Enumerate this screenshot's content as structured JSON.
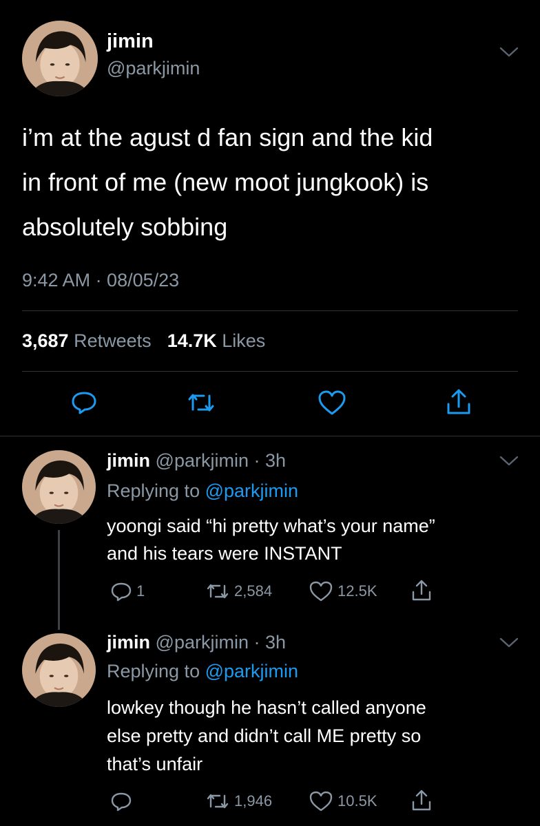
{
  "main_tweet": {
    "display_name": "jimin",
    "handle": "@parkjimin",
    "text_lines": [
      "i’m at the agust d fan sign and the kid",
      "in front of me (new moot jungkook) is",
      "absolutely sobbing"
    ],
    "timestamp": "9:42 AM · 08/05/23",
    "retweets_count": "3,687",
    "retweets_label": "Retweets",
    "likes_count": "14.7K",
    "likes_label": "Likes"
  },
  "replies": [
    {
      "display_name": "jimin",
      "handle_time": "@parkjimin · 3h",
      "replying_prefix": "Replying to",
      "replying_to": "@parkjimin",
      "text_lines": [
        "yoongi said “hi pretty what’s your name”",
        "and his tears were INSTANT"
      ],
      "reply_count": "1",
      "retweet_count": "2,584",
      "like_count": "12.5K"
    },
    {
      "display_name": "jimin",
      "handle_time": "@parkjimin · 3h",
      "replying_prefix": "Replying to",
      "replying_to": "@parkjimin",
      "text_lines": [
        "lowkey though he hasn’t called anyone",
        "else pretty and didn’t call ME pretty so",
        "that’s unfair"
      ],
      "reply_count": "",
      "retweet_count": "1,946",
      "like_count": "10.5K"
    }
  ],
  "icons": {
    "reply": "reply-icon",
    "retweet": "retweet-icon",
    "like": "heart-icon",
    "share": "share-icon",
    "more": "chevron-down-icon"
  },
  "colors": {
    "background": "#000000",
    "accent": "#1d9bf0",
    "muted": "#8b98a5"
  }
}
